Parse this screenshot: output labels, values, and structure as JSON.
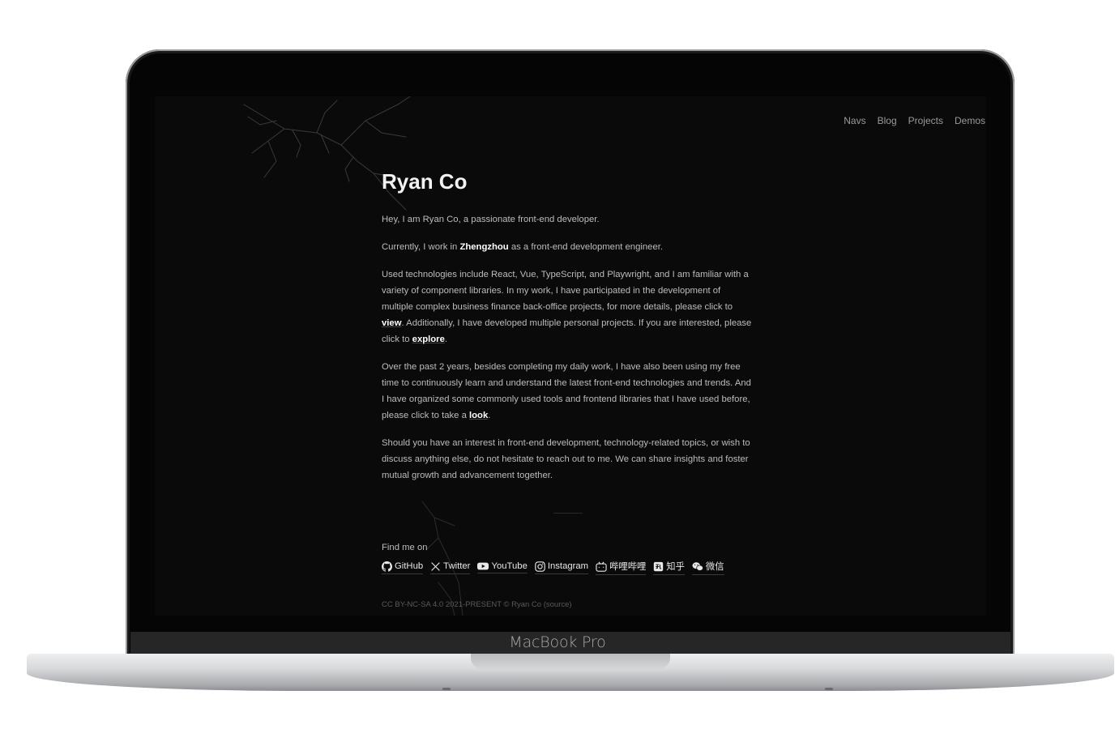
{
  "device": {
    "label": "MacBook Pro"
  },
  "nav": {
    "items": [
      {
        "label": "Navs"
      },
      {
        "label": "Blog"
      },
      {
        "label": "Projects"
      },
      {
        "label": "Demos"
      }
    ]
  },
  "hero": {
    "title": "Ryan Co"
  },
  "paragraphs": {
    "p1": "Hey, I am Ryan Co, a passionate front-end developer.",
    "p2_pre": "Currently, I work in ",
    "p2_link": "Zhengzhou",
    "p2_post": " as a front-end development engineer.",
    "p3_pre": "Used technologies include React, Vue, TypeScript, and Playwright, and I am familiar with a variety of component libraries. In my work, I have participated in the development of multiple complex business finance back-office projects, for more details, please click to ",
    "p3_link1": "view",
    "p3_mid": ". Additionally, I have developed multiple personal projects. If you are interested, please click to ",
    "p3_link2": "explore",
    "p3_post": ".",
    "p4_pre": "Over the past 2 years, besides completing my daily work, I have also been using my free time to continuously learn and understand the latest front-end technologies and trends. And I have organized some commonly used tools and frontend libraries that I have used before, please click to take a ",
    "p4_link": "look",
    "p4_post": ".",
    "p5": "Should you have an interest in front-end development, technology-related topics, or wish to discuss anything else, do not hesitate to reach out to me. We can share insights and foster mutual growth and advancement together."
  },
  "social": {
    "heading": "Find me on",
    "links": [
      {
        "label": "GitHub",
        "icon": "github-icon"
      },
      {
        "label": "Twitter",
        "icon": "x-icon"
      },
      {
        "label": "YouTube",
        "icon": "youtube-icon"
      },
      {
        "label": "Instagram",
        "icon": "instagram-icon"
      },
      {
        "label": "哔哩哔哩",
        "icon": "bilibili-icon"
      },
      {
        "label": "知乎",
        "icon": "zhihu-icon"
      },
      {
        "label": "微信",
        "icon": "wechat-icon"
      }
    ]
  },
  "footer": {
    "text": "CC BY-NC-SA 4.0 2021-PRESENT © Ryan Co (source)"
  }
}
